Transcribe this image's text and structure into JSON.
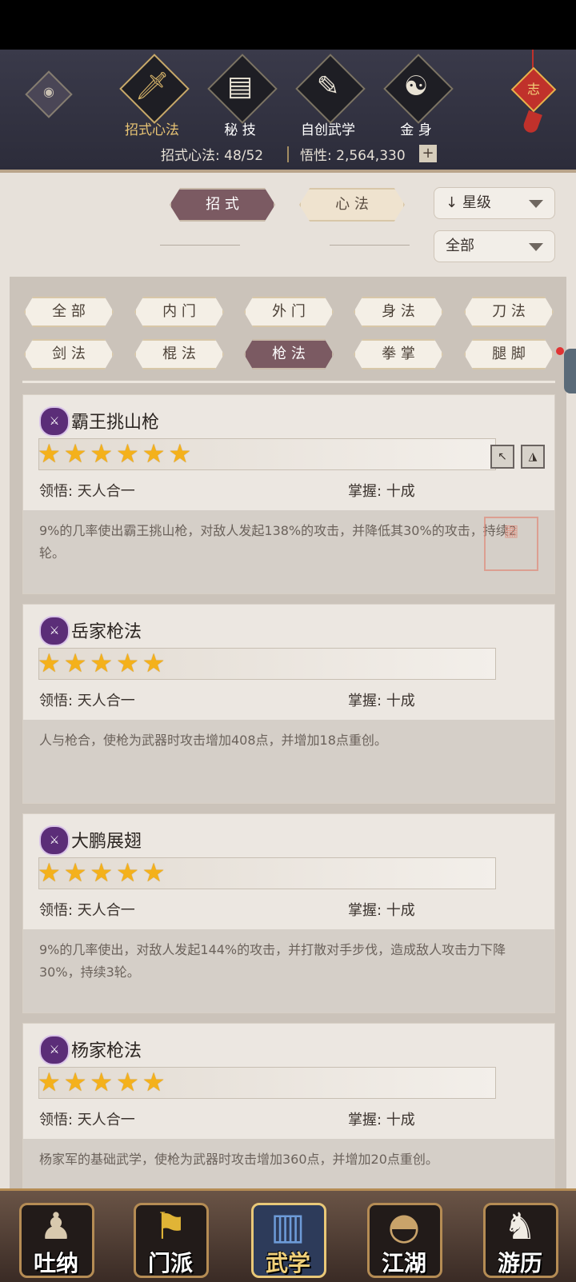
{
  "header": {
    "tabs": [
      {
        "label": "招式心法",
        "icon": "sword-icon",
        "active": true
      },
      {
        "label": "秘 技",
        "icon": "book-icon",
        "active": false
      },
      {
        "label": "自创武学",
        "icon": "scroll-icon",
        "active": false
      },
      {
        "label": "金 身",
        "icon": "meditation-icon",
        "active": false
      }
    ],
    "knot_char": "志",
    "stats_moves": "招式心法: 48/52",
    "stats_insight": "悟性: 2,564,330",
    "plus": "+"
  },
  "toggle": {
    "moves": "招 式",
    "mind": "心 法"
  },
  "sort": {
    "label": "星级",
    "arrow": "↓"
  },
  "filter_all": "全部",
  "chips": {
    "row1": [
      "全 部",
      "内 门",
      "外 门",
      "身 法",
      "刀 法"
    ],
    "row2": [
      "剑 法",
      "棍 法",
      "枪 法",
      "拳 掌",
      "腿 脚"
    ],
    "active": "枪 法"
  },
  "skills": [
    {
      "name": "霸王挑山枪",
      "stars": 6,
      "stars_text": "★★★★★★",
      "comprehension": "领悟: 天人合一",
      "mastery": "掌握: 十成",
      "desc": "9%的几率使出霸王挑山枪，对敌人发起138%的攻击，并降低其30%的攻击，持续2轮。"
    },
    {
      "name": "岳家枪法",
      "stars": 5,
      "stars_text": "★★★★★",
      "comprehension": "领悟: 天人合一",
      "mastery": "掌握: 十成",
      "desc": "人与枪合，使枪为武器时攻击增加408点，并增加18点重创。"
    },
    {
      "name": "大鹏展翅",
      "stars": 5,
      "stars_text": "★★★★★",
      "comprehension": "领悟: 天人合一",
      "mastery": "掌握: 十成",
      "desc": "9%的几率使出，对敌人发起144%的攻击，并打散对手步伐，造成敌人攻击力下降30%，持续3轮。"
    },
    {
      "name": "杨家枪法",
      "stars": 5,
      "stars_text": "★★★★★",
      "comprehension": "领悟: 天人合一",
      "mastery": "掌握: 十成",
      "desc": "杨家军的基础武学，使枪为武器时攻击增加360点，并增加20点重创。"
    }
  ],
  "nav": [
    {
      "label": "吐纳",
      "icon": "figure-icon"
    },
    {
      "label": "门派",
      "icon": "banner-icon"
    },
    {
      "label": "武学",
      "icon": "manual-icon",
      "active": true
    },
    {
      "label": "江湖",
      "icon": "straw-hat-icon"
    },
    {
      "label": "游历",
      "icon": "horse-icon"
    }
  ]
}
